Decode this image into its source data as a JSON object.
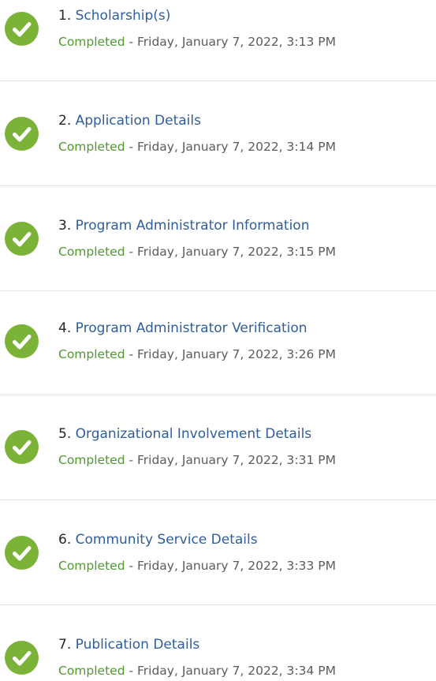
{
  "accent": {
    "check_green": "#7bb339",
    "link_blue": "#2f5e9a",
    "completed_green": "#4e9a2c"
  },
  "steps": [
    {
      "number": "1.",
      "title": "Scholarship(s)",
      "status": "Completed",
      "separator": " - ",
      "timestamp": "Friday, January 7, 2022, 3:13 PM",
      "icon": "check-circle-icon"
    },
    {
      "number": "2.",
      "title": "Application Details",
      "status": "Completed",
      "separator": " - ",
      "timestamp": "Friday, January 7, 2022, 3:14 PM",
      "icon": "check-circle-icon"
    },
    {
      "number": "3.",
      "title": "Program Administrator Information",
      "status": "Completed",
      "separator": " - ",
      "timestamp": "Friday, January 7, 2022, 3:15 PM",
      "icon": "check-circle-icon"
    },
    {
      "number": "4.",
      "title": "Program Administrator Verification",
      "status": "Completed",
      "separator": " - ",
      "timestamp": "Friday, January 7, 2022, 3:26 PM",
      "icon": "check-circle-icon"
    },
    {
      "number": "5.",
      "title": "Organizational Involvement Details",
      "status": "Completed",
      "separator": " - ",
      "timestamp": "Friday, January 7, 2022, 3:31 PM",
      "icon": "check-circle-icon"
    },
    {
      "number": "6.",
      "title": "Community Service Details",
      "status": "Completed",
      "separator": " - ",
      "timestamp": "Friday, January 7, 2022, 3:33 PM",
      "icon": "check-circle-icon"
    },
    {
      "number": "7.",
      "title": "Publication Details",
      "status": "Completed",
      "separator": " - ",
      "timestamp": "Friday, January 7, 2022, 3:34 PM",
      "icon": "check-circle-icon"
    }
  ]
}
